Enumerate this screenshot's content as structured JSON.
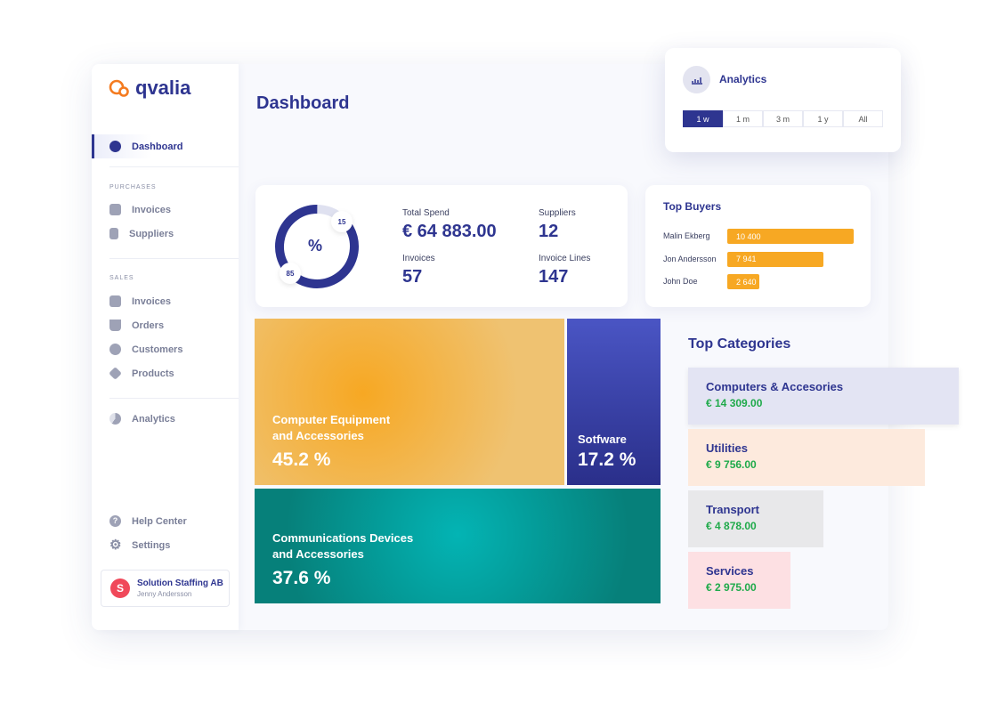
{
  "brand": {
    "name": "qvalia",
    "accent": "#f47b20",
    "primary": "#2e3590"
  },
  "page_title": "Dashboard",
  "sidebar": {
    "dashboard": "Dashboard",
    "purchases_header": "PURCHASES",
    "purchases": [
      {
        "label": "Invoices",
        "icon": "invoice-icon"
      },
      {
        "label": "Suppliers",
        "icon": "building-icon"
      }
    ],
    "sales_header": "SALES",
    "sales": [
      {
        "label": "Invoices",
        "icon": "invoice-icon"
      },
      {
        "label": "Orders",
        "icon": "basket-icon"
      },
      {
        "label": "Customers",
        "icon": "user-icon"
      },
      {
        "label": "Products",
        "icon": "box-icon"
      }
    ],
    "analytics": "Analytics",
    "help": "Help Center",
    "settings": "Settings",
    "account": {
      "company": "Solution Staffing AB",
      "user": "Jenny Andersson"
    }
  },
  "analytics_popup": {
    "title": "Analytics",
    "ranges": [
      "1 w",
      "1 m",
      "3 m",
      "1 y",
      "All"
    ],
    "selected": "1 w"
  },
  "stats": {
    "donut": {
      "center": "%",
      "values": [
        85,
        15
      ]
    },
    "total_spend_label": "Total Spend",
    "total_spend": "€ 64 883.00",
    "suppliers_label": "Suppliers",
    "suppliers": "12",
    "invoices_label": "Invoices",
    "invoices": "57",
    "invoice_lines_label": "Invoice Lines",
    "invoice_lines": "147"
  },
  "top_buyers": {
    "title": "Top Buyers",
    "items": [
      {
        "name": "Malin Ekberg",
        "value": "10 400",
        "amount": 10400
      },
      {
        "name": "Jon Andersson",
        "value": "7 941",
        "amount": 7941
      },
      {
        "name": "John Doe",
        "value": "2 640",
        "amount": 2640
      }
    ]
  },
  "treemap": [
    {
      "name": "Computer Equipment and Accessories",
      "line1": "Computer Equipment",
      "line2": "and Accessories",
      "pct": "45.2 %"
    },
    {
      "name": "Sotfware",
      "line1": "Sotfware",
      "line2": "",
      "pct": "17.2 %"
    },
    {
      "name": "Communications Devices and Accessories",
      "line1": "Communications Devices",
      "line2": "and Accessories",
      "pct": "37.6 %"
    }
  ],
  "top_categories": {
    "title": "Top Categories",
    "items": [
      {
        "name": "Computers & Accesories",
        "value": "€ 14 309.00",
        "color": "#e3e4f3"
      },
      {
        "name": "Utilities",
        "value": "€ 9 756.00",
        "color": "#fdeadd"
      },
      {
        "name": "Transport",
        "value": "€ 4 878.00",
        "color": "#e8e8ea"
      },
      {
        "name": "Services",
        "value": "€ 2 975.00",
        "color": "#fde0e3"
      }
    ]
  }
}
